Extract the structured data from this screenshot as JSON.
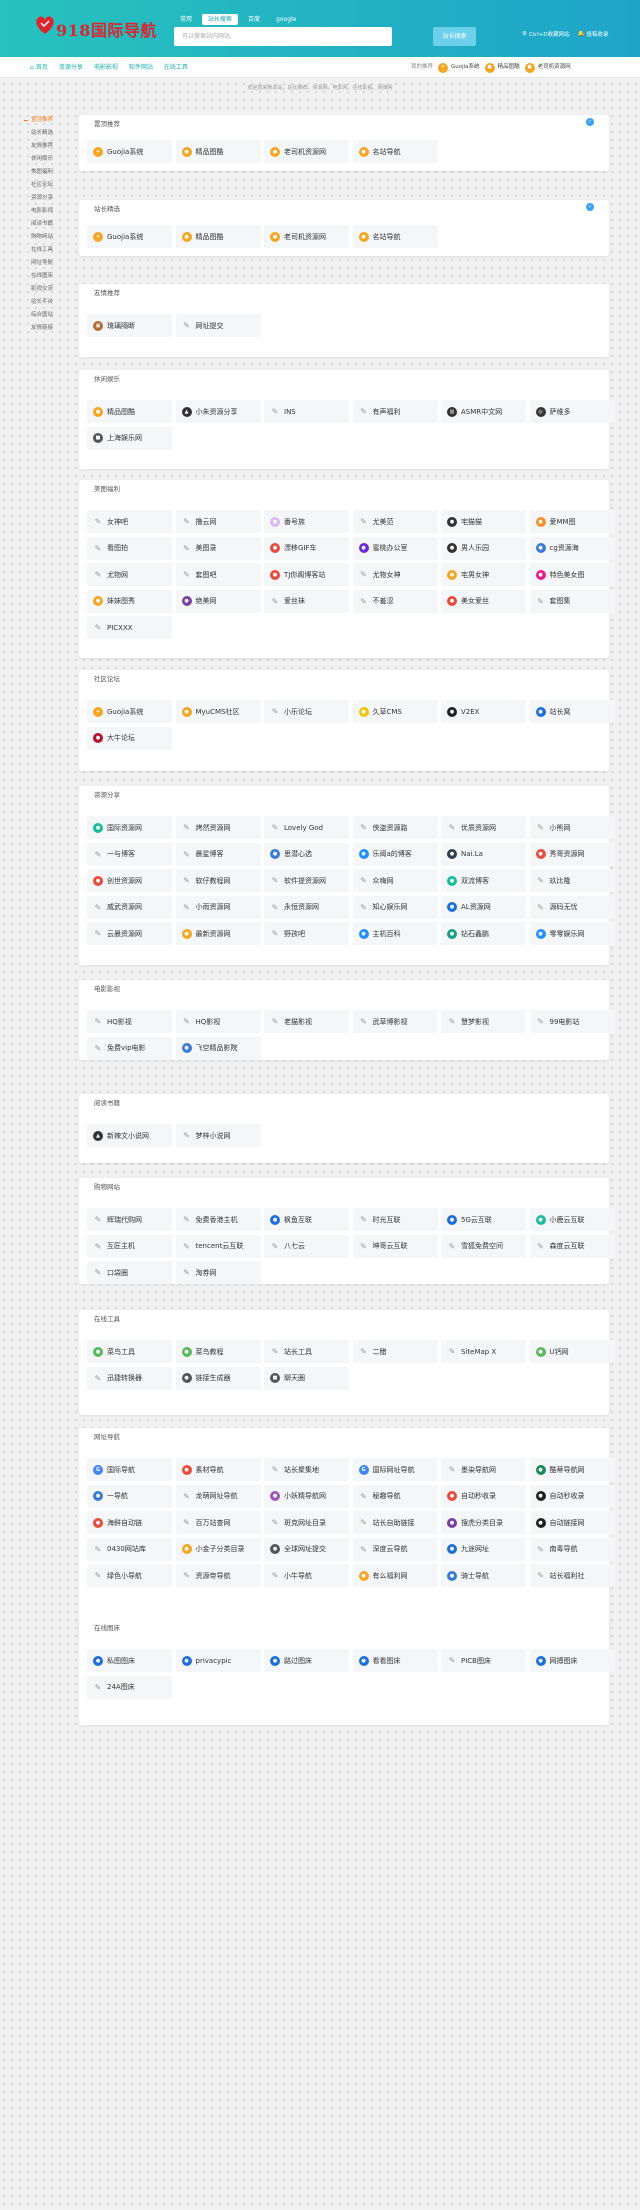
{
  "header": {
    "logo_text": "918国际导航",
    "search_tabs": [
      "常用",
      "站长搜索",
      "百度",
      "google"
    ],
    "search_placeholder": "可以搜索站内网站",
    "search_button": "站长搜索",
    "links": [
      "Ctrl+D收藏网站",
      "投稿收录"
    ]
  },
  "subnav": {
    "items": [
      "首页",
      "资源分享",
      "电影影视",
      "软件网站",
      "在线工具"
    ],
    "friend_label": "我的推荐",
    "friends": [
      "Guojia系统",
      "精品图酷",
      "老司机资源网"
    ]
  },
  "breadcrumb": "欢迎您来到本站，站长推荐，资源网，电影网，在线影视，网赚网",
  "sidebar": {
    "items": [
      "置顶推荐",
      "站长精选",
      "友情推荐",
      "休闲娱乐",
      "美图福利",
      "社区论坛",
      "资源分享",
      "电影影视",
      "阅读书籍",
      "购物网站",
      "在线工具",
      "网址导航",
      "在线图床",
      "影视交流",
      "站长平台",
      "综合图站",
      "友情链接"
    ]
  },
  "colors": {
    "accent": "#1fb2b0",
    "active": "#f4811f",
    "header_from": "#27c2bd",
    "header_to": "#1fa4c9"
  },
  "sections": [
    {
      "title": "置顶推荐",
      "badge": true,
      "items": [
        {
          "name": "Guojia系统",
          "icon": "dove",
          "color": "#f4a623"
        },
        {
          "name": "精品图酷",
          "icon": "coin",
          "color": "#f4a623"
        },
        {
          "name": "老司机资源网",
          "icon": "coin",
          "color": "#f4a623"
        },
        {
          "name": "名站导航",
          "icon": "coin",
          "color": "#f4a623"
        }
      ]
    },
    {
      "title": "站长精选",
      "badge": true,
      "items": [
        {
          "name": "Guojia系统",
          "icon": "dove",
          "color": "#f4a623"
        },
        {
          "name": "精品图酷",
          "icon": "coin",
          "color": "#f4a623"
        },
        {
          "name": "老司机资源网",
          "icon": "coin",
          "color": "#f4a623"
        },
        {
          "name": "名站导航",
          "icon": "coin",
          "color": "#f4a623"
        }
      ]
    },
    {
      "title": "友情推荐",
      "badge": false,
      "items": [
        {
          "name": "琉璃隔断",
          "icon": "img",
          "color": "#b46b3a"
        },
        {
          "name": "网址提交",
          "icon": "pen"
        }
      ]
    },
    {
      "title": "休闲娱乐",
      "badge": false,
      "items": [
        {
          "name": "精品图酷",
          "icon": "coin",
          "color": "#f4a623"
        },
        {
          "name": "小朱资源分享",
          "icon": "tri",
          "color": "#333333"
        },
        {
          "name": "INS",
          "icon": "pen"
        },
        {
          "name": "有声福利",
          "icon": "pen"
        },
        {
          "name": "ASMR中文网",
          "icon": "bar",
          "color": "#333333"
        },
        {
          "name": "萨维多",
          "icon": "ring",
          "color": "#333333"
        },
        {
          "name": "上海娱乐网",
          "icon": "sq",
          "color": "#555555"
        }
      ]
    },
    {
      "title": "美图福利",
      "badge": false,
      "items": [
        {
          "name": "女神吧",
          "icon": "pen"
        },
        {
          "name": "撸云网",
          "icon": "pen"
        },
        {
          "name": "番号族",
          "icon": "c",
          "color": "#d9b8ee"
        },
        {
          "name": "尤美范",
          "icon": "pen"
        },
        {
          "name": "宅猫猫",
          "icon": "c",
          "color": "#333333"
        },
        {
          "name": "爱MM图",
          "icon": "c",
          "color": "#f48f2a"
        },
        {
          "name": "看图拍",
          "icon": "pen"
        },
        {
          "name": "美图录",
          "icon": "pen"
        },
        {
          "name": "漂移GIF车",
          "icon": "c",
          "color": "#e74c3c"
        },
        {
          "name": "蜜桃办公室",
          "icon": "c",
          "color": "#6c2bd9"
        },
        {
          "name": "男人乐园",
          "icon": "c",
          "color": "#333333"
        },
        {
          "name": "cg资源海",
          "icon": "c",
          "color": "#3a7bd5"
        },
        {
          "name": "尤物网",
          "icon": "pen"
        },
        {
          "name": "套图吧",
          "icon": "pen"
        },
        {
          "name": "TJ你阁博客站",
          "icon": "c",
          "color": "#e74c3c"
        },
        {
          "name": "尤物女神",
          "icon": "pen"
        },
        {
          "name": "宅男女神",
          "icon": "c",
          "color": "#f4a623"
        },
        {
          "name": "特色美女图",
          "icon": "c",
          "color": "#e91e8c"
        },
        {
          "name": "妹妹图秀",
          "icon": "c",
          "color": "#f4a623"
        },
        {
          "name": "绝美网",
          "icon": "c",
          "color": "#7b3fa0"
        },
        {
          "name": "爱丝袜",
          "icon": "pen"
        },
        {
          "name": "不羞涩",
          "icon": "pen"
        },
        {
          "name": "美女爱丝",
          "icon": "c",
          "color": "#e74c3c"
        },
        {
          "name": "套图集",
          "icon": "pen"
        },
        {
          "name": "PICXXX",
          "icon": "pen"
        }
      ]
    },
    {
      "title": "社区论坛",
      "badge": false,
      "items": [
        {
          "name": "Guojia系统",
          "icon": "dove",
          "color": "#f4a623"
        },
        {
          "name": "MyuCMS社区",
          "icon": "c",
          "color": "#f4a623"
        },
        {
          "name": "小乐论坛",
          "icon": "pen"
        },
        {
          "name": "久草CMS",
          "icon": "c",
          "color": "#f1c40f"
        },
        {
          "name": "V2EX",
          "icon": "c",
          "color": "#222222"
        },
        {
          "name": "站长窝",
          "icon": "c",
          "color": "#1e6fd9"
        },
        {
          "name": "大牛论坛",
          "icon": "c",
          "color": "#b2132f"
        }
      ]
    },
    {
      "title": "资源分享",
      "badge": false,
      "items": [
        {
          "name": "国际资源网",
          "icon": "c",
          "color": "#1abc9c"
        },
        {
          "name": "烤然资源网",
          "icon": "pen"
        },
        {
          "name": "Lovely God",
          "icon": "pen"
        },
        {
          "name": "侠盗资源路",
          "icon": "pen"
        },
        {
          "name": "优质资源网",
          "icon": "pen"
        },
        {
          "name": "小熊网",
          "icon": "pen"
        },
        {
          "name": "一与博客",
          "icon": "pen"
        },
        {
          "name": "晨星博客",
          "icon": "pen"
        },
        {
          "name": "思潜心选",
          "icon": "c",
          "color": "#3a7bd5"
        },
        {
          "name": "乐阈a的博客",
          "icon": "c",
          "color": "#1e90ff"
        },
        {
          "name": "Nai.La",
          "icon": "c",
          "color": "#2c3e50"
        },
        {
          "name": "秀哥资源网",
          "icon": "c",
          "color": "#e74c3c"
        },
        {
          "name": "创世资源网",
          "icon": "c",
          "color": "#e74c3c"
        },
        {
          "name": "软仔教程网",
          "icon": "pen"
        },
        {
          "name": "软件提资源网",
          "icon": "pen"
        },
        {
          "name": "众嗨网",
          "icon": "pen"
        },
        {
          "name": "双流博客",
          "icon": "c",
          "color": "#1abc9c"
        },
        {
          "name": "玖比隆",
          "icon": "pen"
        },
        {
          "name": "威武资源网",
          "icon": "pen"
        },
        {
          "name": "小雨资源网",
          "icon": "pen"
        },
        {
          "name": "永恒资源网",
          "icon": "pen"
        },
        {
          "name": "知心娱乐网",
          "icon": "pen"
        },
        {
          "name": "AL资源网",
          "icon": "c",
          "color": "#1e6fd9"
        },
        {
          "name": "源码无忧",
          "icon": "pen"
        },
        {
          "name": "云晨资源网",
          "icon": "pen"
        },
        {
          "name": "最新资源网",
          "icon": "c",
          "color": "#f4a623"
        },
        {
          "name": "野孩吧",
          "icon": "pen"
        },
        {
          "name": "主机百科",
          "icon": "c",
          "color": "#1e90ff"
        },
        {
          "name": "钻石鑫鹏",
          "icon": "c",
          "color": "#16a085"
        },
        {
          "name": "零零娱乐网",
          "icon": "c",
          "color": "#1e90ff"
        }
      ]
    },
    {
      "title": "电影影视",
      "badge": false,
      "items": [
        {
          "name": "HQ影视",
          "icon": "pen"
        },
        {
          "name": "HQ影视",
          "icon": "pen"
        },
        {
          "name": "老猫影视",
          "icon": "pen"
        },
        {
          "name": "武草博影视",
          "icon": "pen"
        },
        {
          "name": "慧梦影视",
          "icon": "pen"
        },
        {
          "name": "99电影站",
          "icon": "pen"
        },
        {
          "name": "免费vip电影",
          "icon": "pen"
        },
        {
          "name": "飞空精品影院",
          "icon": "c",
          "color": "#3a7bd5"
        }
      ]
    },
    {
      "title": "阅读书籍",
      "badge": false,
      "items": [
        {
          "name": "新辣文小说网",
          "icon": "tri",
          "color": "#333333"
        },
        {
          "name": "梦梓小说网",
          "icon": "pen"
        }
      ]
    },
    {
      "title": "购物网站",
      "badge": false,
      "items": [
        {
          "name": "辉瑞代购网",
          "icon": "pen"
        },
        {
          "name": "免费香港主机",
          "icon": "pen"
        },
        {
          "name": "枫鱼互联",
          "icon": "c",
          "color": "#1e6fd9"
        },
        {
          "name": "时光互联",
          "icon": "pen"
        },
        {
          "name": "5G云互联",
          "icon": "c",
          "color": "#1e6fd9"
        },
        {
          "name": "小鹿云互联",
          "icon": "c",
          "color": "#1abc9c"
        },
        {
          "name": "互匠主机",
          "icon": "pen"
        },
        {
          "name": "tencent云互联",
          "icon": "pen"
        },
        {
          "name": "八七云",
          "icon": "pen"
        },
        {
          "name": "坤哥云互联",
          "icon": "pen"
        },
        {
          "name": "雪狐免费空间",
          "icon": "pen"
        },
        {
          "name": "森度云互联",
          "icon": "pen"
        },
        {
          "name": "口袋圈",
          "icon": "pen"
        },
        {
          "name": "淘券网",
          "icon": "pen"
        }
      ]
    },
    {
      "title": "在线工具",
      "badge": false,
      "items": [
        {
          "name": "菜鸟工具",
          "icon": "c",
          "color": "#5cb85c"
        },
        {
          "name": "菜鸟教程",
          "icon": "c",
          "color": "#5cb85c"
        },
        {
          "name": "站长工具",
          "icon": "pen"
        },
        {
          "name": "二醋",
          "icon": "pen"
        },
        {
          "name": "SiteMap X",
          "icon": "pen"
        },
        {
          "name": "U钙网",
          "icon": "c",
          "color": "#5cb85c"
        },
        {
          "name": "迅捷转换器",
          "icon": "pen"
        },
        {
          "name": "链接生成器",
          "icon": "c",
          "color": "#555555"
        },
        {
          "name": "聊天圈",
          "icon": "sq",
          "color": "#555555"
        }
      ]
    },
    {
      "title": "网址导航",
      "badge": false,
      "items": [
        {
          "name": "国际导航",
          "icon": "g",
          "color": "#4285f4"
        },
        {
          "name": "素材导航",
          "icon": "c",
          "color": "#e74c3c"
        },
        {
          "name": "站长聚集地",
          "icon": "pen"
        },
        {
          "name": "国际网址导航",
          "icon": "g",
          "color": "#4285f4"
        },
        {
          "name": "墨染导航网",
          "icon": "pen"
        },
        {
          "name": "酷蒂导航网",
          "icon": "c",
          "color": "#1a8a5c"
        },
        {
          "name": "一导航",
          "icon": "c",
          "color": "#3a7bd5"
        },
        {
          "name": "龙萌网址导航",
          "icon": "pen"
        },
        {
          "name": "小妖精导航网",
          "icon": "c",
          "color": "#9b59b6"
        },
        {
          "name": "秘趣导航",
          "icon": "pen"
        },
        {
          "name": "自动秒收录",
          "icon": "c",
          "color": "#e74c3c"
        },
        {
          "name": "自动秒收录",
          "icon": "c",
          "color": "#222222"
        },
        {
          "name": "海鲜自动链",
          "icon": "c",
          "color": "#e74c3c"
        },
        {
          "name": "百万站查网",
          "icon": "pen"
        },
        {
          "name": "斑克网址目录",
          "icon": "pen"
        },
        {
          "name": "站长自助链接",
          "icon": "pen"
        },
        {
          "name": "搜虎分类目录",
          "icon": "c",
          "color": "#7b3fa0"
        },
        {
          "name": "自动链接网",
          "icon": "c",
          "color": "#222222"
        },
        {
          "name": "0430网站库",
          "icon": "pen"
        },
        {
          "name": "小金子分类目录",
          "icon": "c",
          "color": "#f4a623"
        },
        {
          "name": "全球网址提交",
          "icon": "c",
          "color": "#555555"
        },
        {
          "name": "深度云导航",
          "icon": "pen"
        },
        {
          "name": "九途网址",
          "icon": "c",
          "color": "#1e6fd9"
        },
        {
          "name": "南毒导航",
          "icon": "pen"
        },
        {
          "name": "绿色小导航",
          "icon": "pen"
        },
        {
          "name": "资源帝导航",
          "icon": "pen"
        },
        {
          "name": "小牛导航",
          "icon": "pen"
        },
        {
          "name": "有么福利网",
          "icon": "c",
          "color": "#f4a623"
        },
        {
          "name": "骑士导航",
          "icon": "c",
          "color": "#3a7bd5"
        },
        {
          "name": "站长福利社",
          "icon": "pen"
        }
      ]
    },
    {
      "title": "在线图床",
      "badge": false,
      "items": [
        {
          "name": "私图图床",
          "icon": "c",
          "color": "#1e6fd9"
        },
        {
          "name": "privacypic",
          "icon": "c",
          "color": "#1e6fd9"
        },
        {
          "name": "路过图床",
          "icon": "c",
          "color": "#1e6fd9"
        },
        {
          "name": "看看图床",
          "icon": "c",
          "color": "#1e6fd9"
        },
        {
          "name": "PICB图床",
          "icon": "pen"
        },
        {
          "name": "网搏图床",
          "icon": "c",
          "color": "#1e6fd9"
        },
        {
          "name": "24A图床",
          "icon": "pen"
        }
      ]
    }
  ]
}
